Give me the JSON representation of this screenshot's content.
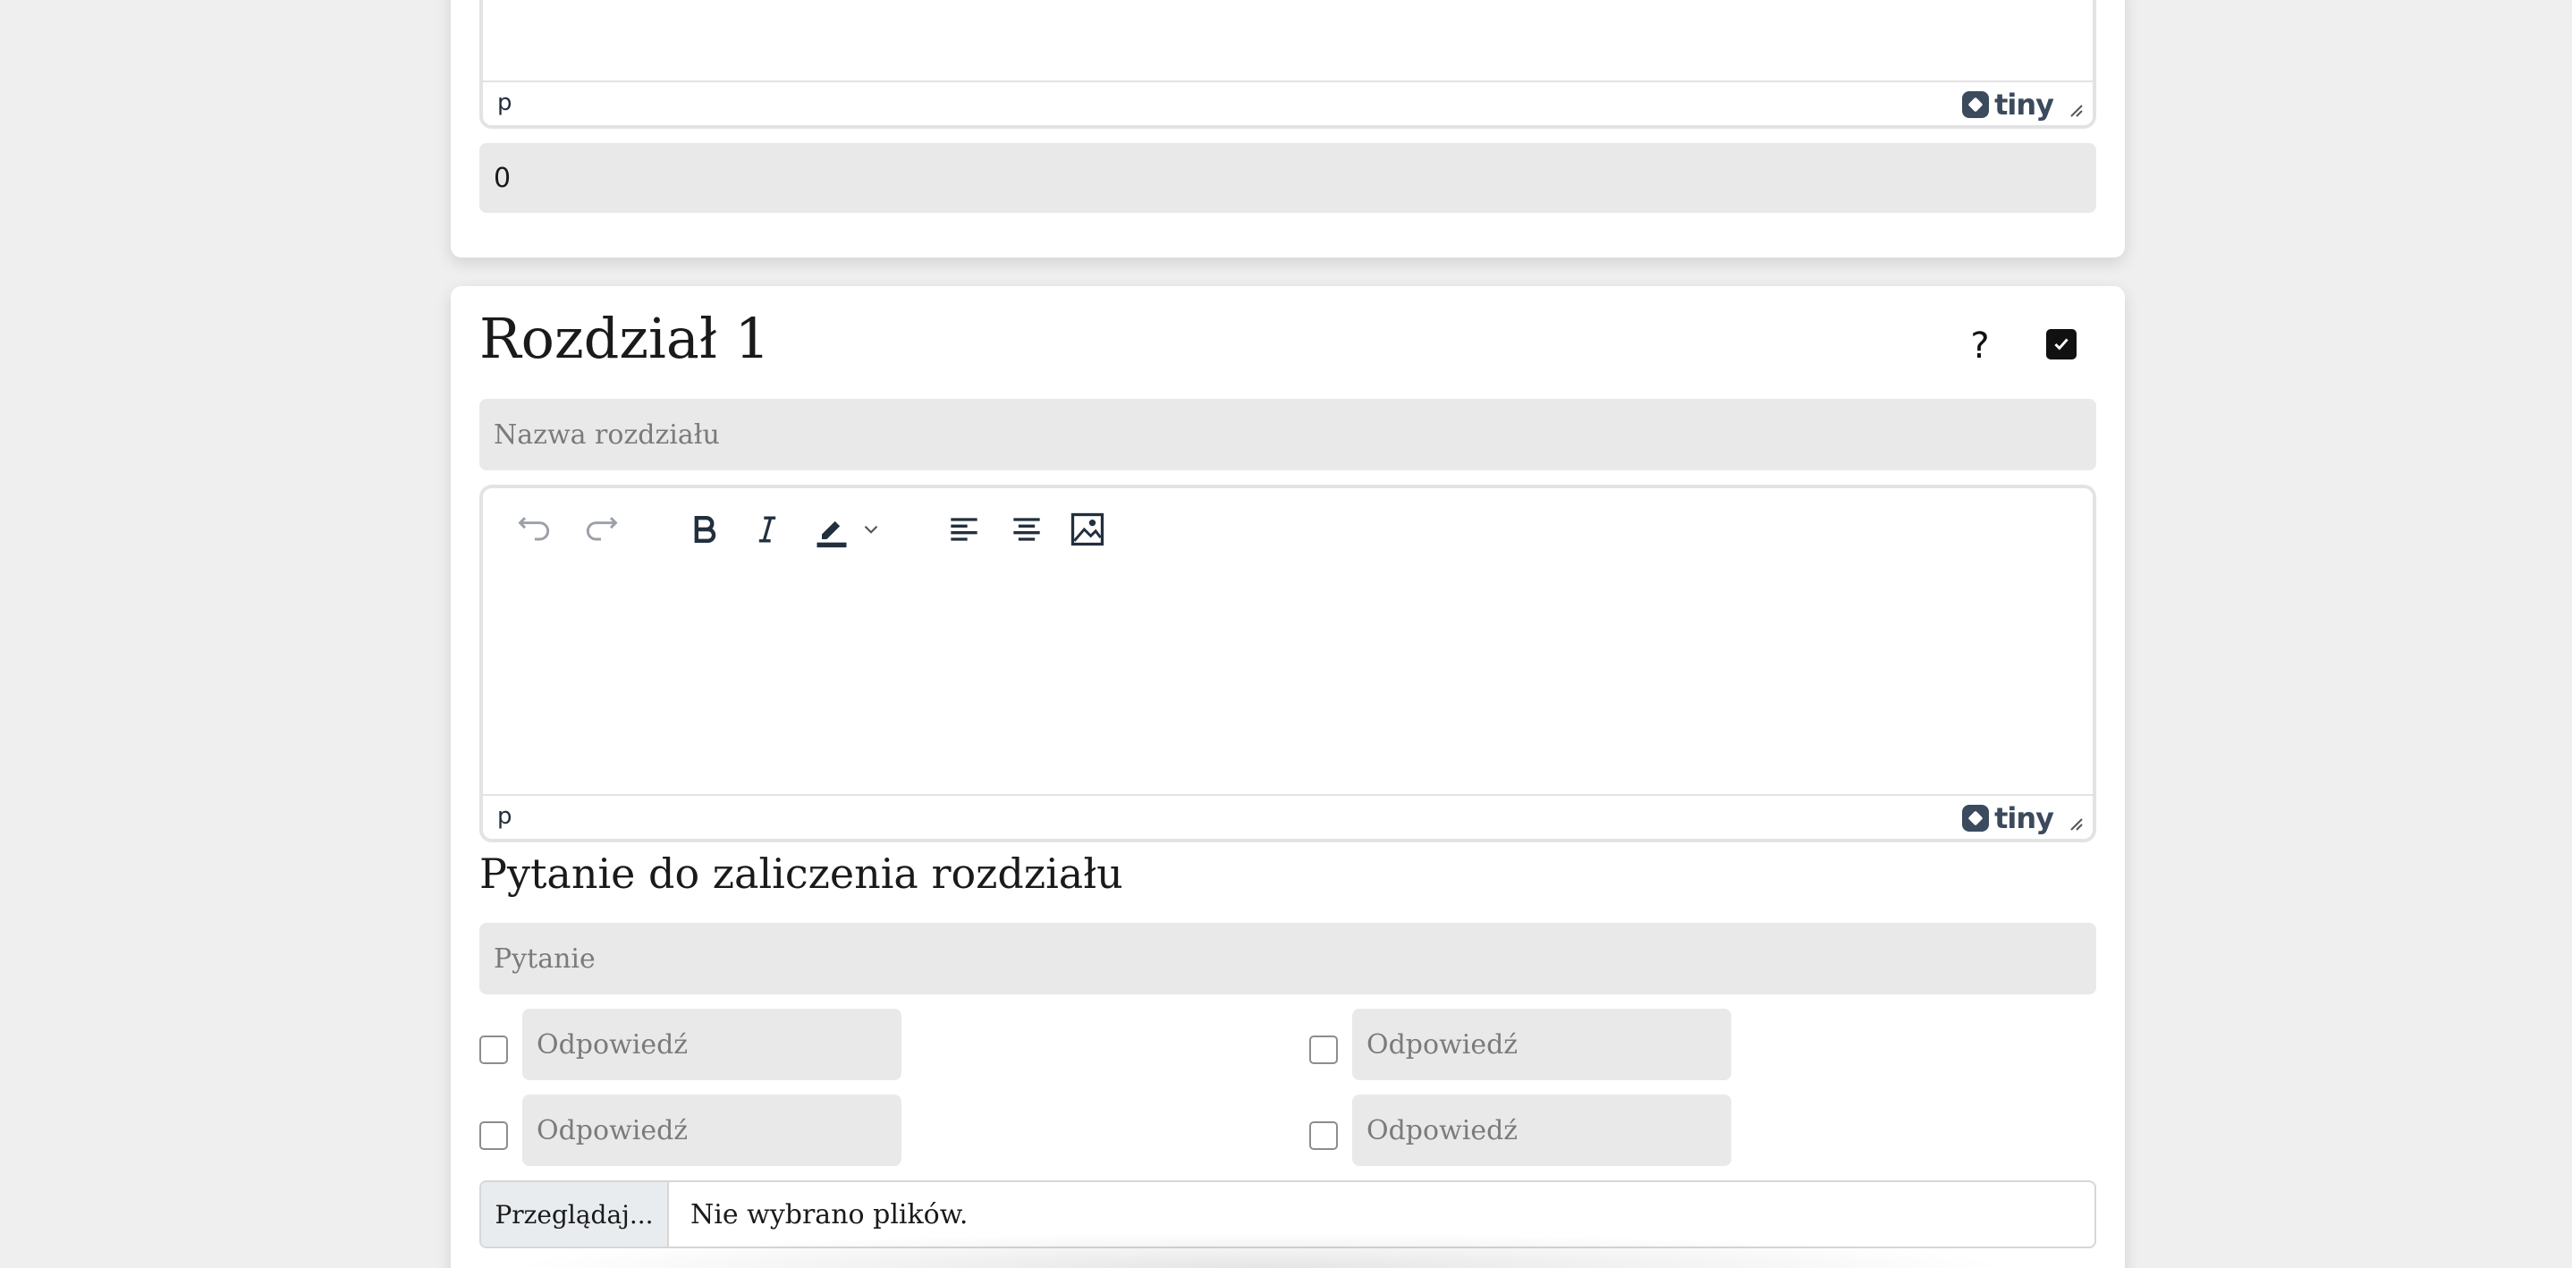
{
  "top_section": {
    "status_path": "p",
    "brand": "tiny",
    "value_field": "0"
  },
  "chapter": {
    "title": "Rozdział 1",
    "help_label": "?",
    "name_placeholder": "Nazwa rozdziału",
    "editor": {
      "status_path": "p",
      "brand": "tiny",
      "toolbar": [
        "undo-icon",
        "redo-icon",
        "bold-icon",
        "italic-icon",
        "highlight-icon",
        "chevron-down-icon",
        "align-left-icon",
        "align-center-icon",
        "image-icon"
      ]
    },
    "question_heading": "Pytanie do zaliczenia rozdziału",
    "question_placeholder": "Pytanie",
    "answers": [
      {
        "placeholder": "Odpowiedź"
      },
      {
        "placeholder": "Odpowiedź"
      },
      {
        "placeholder": "Odpowiedź"
      },
      {
        "placeholder": "Odpowiedź"
      }
    ],
    "file": {
      "button_label": "Przeglądaj...",
      "status": "Nie wybrano plików."
    }
  }
}
